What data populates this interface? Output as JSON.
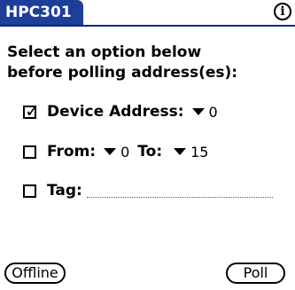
{
  "header": {
    "title": "HPC301",
    "info_icon": "info-icon"
  },
  "instructions": {
    "line1": "Select an option below",
    "line2": "before polling address(es):"
  },
  "device_address": {
    "label": "Device Address:",
    "value": "0",
    "checked": true
  },
  "range": {
    "from_label": "From:",
    "from_value": "0",
    "to_label": "To:",
    "to_value": "15",
    "checked": false
  },
  "tag": {
    "label": "Tag:",
    "value": "",
    "checked": false
  },
  "buttons": {
    "offline": "Offline",
    "poll": "Poll"
  }
}
